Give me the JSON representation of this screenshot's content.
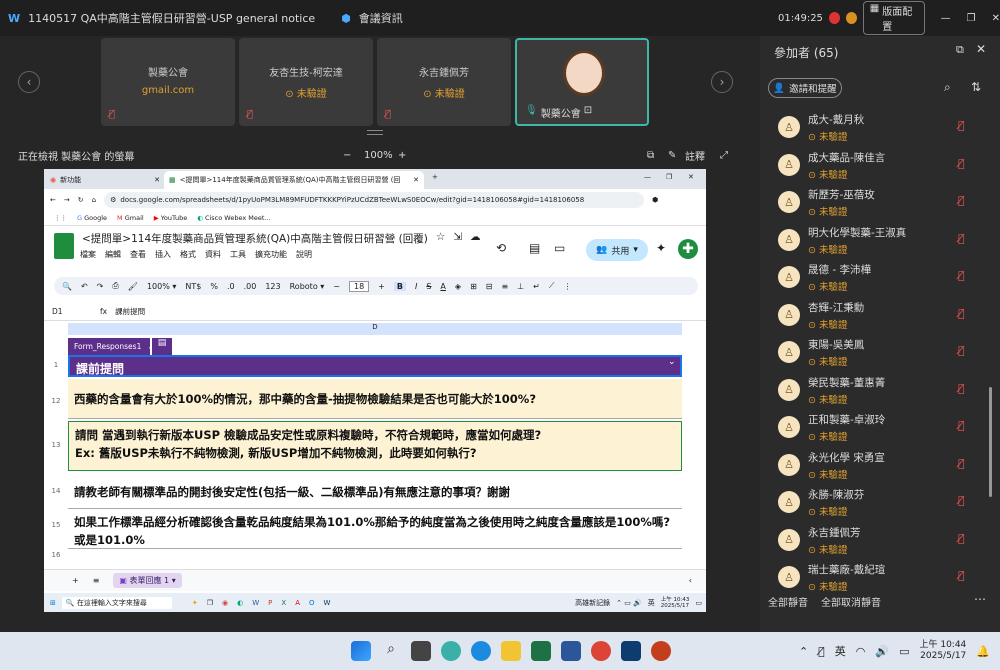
{
  "window": {
    "app_title": "1140517 QA中高階主管假日研習營-USP general notice",
    "meeting_info": "會議資訊",
    "time": "01:49:25",
    "layout_btn": "版面配置"
  },
  "tiles": [
    {
      "name": "製藥公會",
      "sub": "gmail.com",
      "sub_color": "#e0a030"
    },
    {
      "name": "友杏生技-柯宏達",
      "sub": "未驗證"
    },
    {
      "name": "永吉鍾佩芳",
      "sub": "未驗證"
    },
    {
      "name": "製藥公會"
    }
  ],
  "viewbar": {
    "label": "正在檢視 製藥公會 的螢幕",
    "zoom": "100%",
    "annotate": "註釋"
  },
  "browser": {
    "tabs": [
      "新功能",
      "<提問單>114年度製藥商品質管理系統(QA)中高階主管假日研習營 (回覆)"
    ],
    "url": "docs.google.com/spreadsheets/d/1pyUoPM3LM89MFUDFTKKKPYiPzUCdZBTeeWLwS0EOCw/edit?gid=1418106058#gid=1418106058",
    "bookmarks": [
      "Google",
      "Gmail",
      "YouTube",
      "Cisco Webex Meet..."
    ],
    "doc_title": "<提問單>114年度製藥商品質管理系統(QA)中高階主管假日研習營 (回覆)",
    "menus": [
      "檔案",
      "編輯",
      "查看",
      "插入",
      "格式",
      "資料",
      "工具",
      "擴充功能",
      "說明"
    ],
    "share_btn": "共用",
    "toolbar": {
      "zoom": "100%",
      "currency": "NT$",
      "percent": "%",
      "dec_minus": ".0",
      "dec_plus": ".00",
      "num_fmt": "123",
      "font": "Roboto",
      "font_size": "18"
    },
    "cell_ref": "D1",
    "formula": "課前提問",
    "col_header": "D",
    "table_name": "Form_Responses1",
    "header_cell": "課前提問",
    "rows": [
      {
        "num": "1",
        "text": ""
      },
      {
        "num": "12",
        "text": "西藥的含量會有大於100%的情況，那中藥的含量-抽提物檢驗結果是否也可能大於100%?"
      },
      {
        "num": "13",
        "text": "請問 當遇到執行新版本USP 檢驗成品安定性或原料複驗時，不符合規範時，應當如何處理?\nEx: 舊版USP未執行不純物檢測, 新版USP增加不純物檢測，此時要如何執行?"
      },
      {
        "num": "14",
        "text": "請教老師有關標準品的開封後安定性(包括一級、二級標準品)有無應注意的事項？謝謝"
      },
      {
        "num": "15",
        "text": "如果工作標準品經分析確認後含量乾品純度結果為101.0%那給予的純度當為之後使用時之純度含量應該是100%嗎?或是101.0%"
      },
      {
        "num": "16",
        "text": ""
      }
    ],
    "sheet_tab": "表單回應 1",
    "win_search": "在這裡輸入文字來搜尋",
    "inner_clock": "上午 10:43\n2025/5/17",
    "inner_news": "高雄新記錄",
    "inner_lang": "英"
  },
  "participants": {
    "title": "參加者 (65)",
    "invite": "邀請和提醒",
    "list": [
      {
        "name": "成大-戴月秋",
        "status": "未驗證"
      },
      {
        "name": "成大藥品-陳佳言",
        "status": "未驗證"
      },
      {
        "name": "新歷芳-巫蓓玫",
        "status": "未驗證"
      },
      {
        "name": "明大化學製藥-王淑真",
        "status": "未驗證"
      },
      {
        "name": "晟德 - 李沛樺",
        "status": "未驗證"
      },
      {
        "name": "杏輝-江秉勳",
        "status": "未驗證"
      },
      {
        "name": "東陽-吳美鳳",
        "status": "未驗證"
      },
      {
        "name": "榮民製藥-董惠菁",
        "status": "未驗證"
      },
      {
        "name": "正和製藥-卓淑玲",
        "status": "未驗證"
      },
      {
        "name": "永光化學 宋勇宣",
        "status": "未驗證"
      },
      {
        "name": "永勝-陳淑芬",
        "status": "未驗證"
      },
      {
        "name": "永吉鍾佩芳",
        "status": "未驗證"
      },
      {
        "name": "瑞士藥廠-戴紀瑄",
        "status": "未驗證"
      }
    ],
    "mute_all": "全部靜音",
    "unmute_all": "全部取消靜音"
  },
  "taskbar": {
    "lang": "英",
    "time": "上午 10:44",
    "date": "2025/5/17"
  }
}
